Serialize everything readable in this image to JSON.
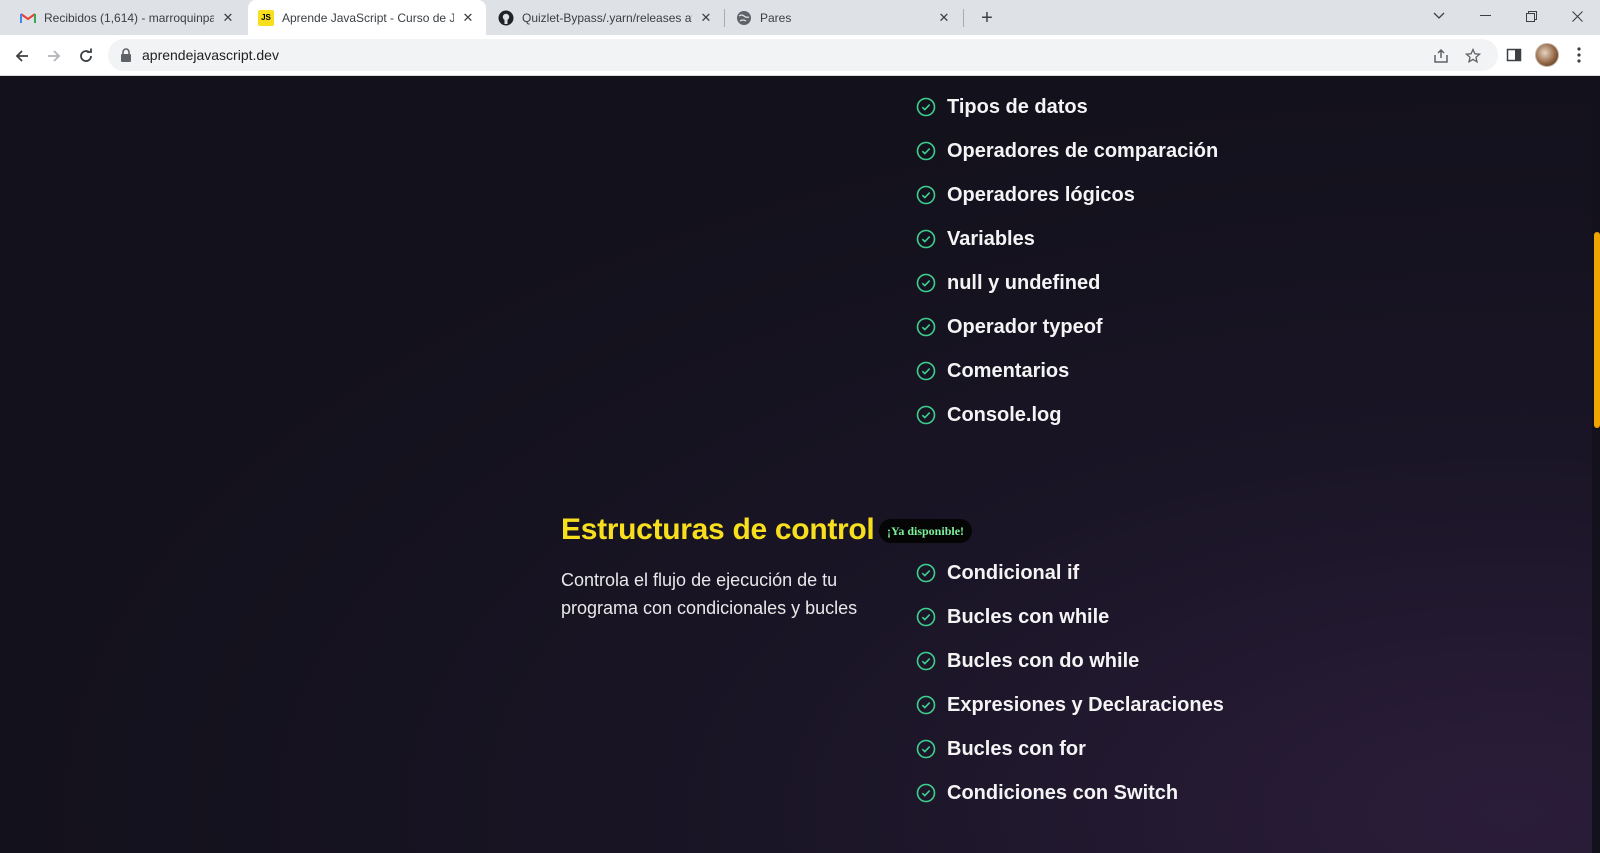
{
  "browser": {
    "tabs": [
      {
        "title": "Recibidos (1,614) - marroquinpan",
        "favicon": "gmail-icon",
        "active": false
      },
      {
        "title": "Aprende JavaScript - Curso de Ja",
        "favicon": "js-icon",
        "active": true
      },
      {
        "title": "Quizlet-Bypass/.yarn/releases at",
        "favicon": "github-icon",
        "active": false
      },
      {
        "title": "Pares",
        "favicon": "globe-icon",
        "active": false
      }
    ],
    "favicon_text": {
      "js": "JS"
    },
    "url": "aprendejavascript.dev",
    "colors": {
      "accent": "#f7df1e",
      "scrollbar": "#f0a400",
      "check": "#3ecf8e",
      "badge_text": "#7cf29c"
    }
  },
  "content": {
    "previous_topics": [
      "Tipos de datos",
      "Operadores de comparación",
      "Operadores lógicos",
      "Variables",
      "null y undefined",
      "Operador typeof",
      "Comentarios",
      "Console.log"
    ],
    "section": {
      "title": "Estructuras de control",
      "badge": "¡Ya disponible!",
      "description": "Controla el flujo de ejecución de tu programa con condicionales y bucles",
      "topics": [
        "Condicional if",
        "Bucles con while",
        "Bucles con do while",
        "Expresiones y Declaraciones",
        "Bucles con for",
        "Condiciones con Switch"
      ]
    }
  }
}
